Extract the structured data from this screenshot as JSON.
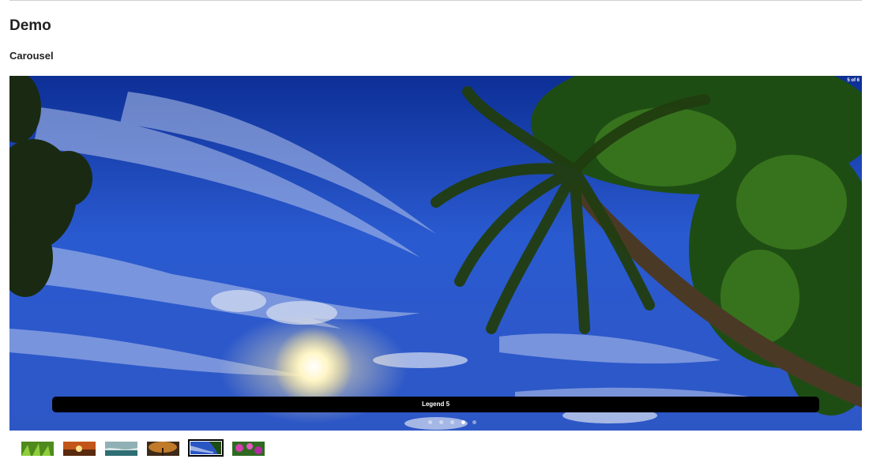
{
  "page": {
    "title": "Demo",
    "section_title": "Carousel"
  },
  "carousel": {
    "counter": "5 of 6",
    "legend": "Legend 5",
    "current_index": 5,
    "total": 6,
    "slide_image": "palm-trees-sunset-sky",
    "dots": [
      {
        "active": false
      },
      {
        "active": false
      },
      {
        "active": false
      },
      {
        "active": true
      },
      {
        "active": false
      }
    ],
    "thumbnails": [
      {
        "image": "green-grass",
        "active": false
      },
      {
        "image": "orange-sunset",
        "active": false
      },
      {
        "image": "sea-coast",
        "active": false
      },
      {
        "image": "autumn-tree",
        "active": false
      },
      {
        "image": "blue-sky-palms",
        "active": true
      },
      {
        "image": "purple-flowers",
        "active": false
      }
    ]
  },
  "colors": {
    "legend_bg": "#000000",
    "sky_blue": "#1f47b8",
    "text": "#222222"
  }
}
